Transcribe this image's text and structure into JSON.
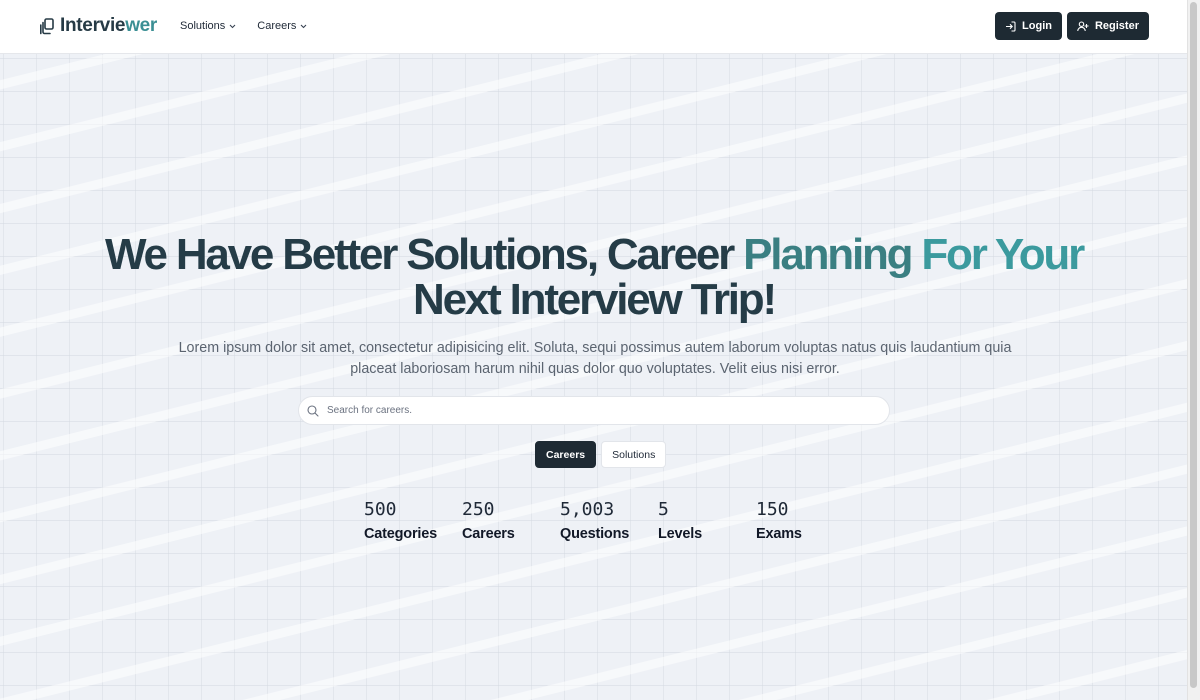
{
  "brand": {
    "name_part1": "Intervie",
    "name_part2": "wer",
    "accent_color": "#3b8f94",
    "dark_color": "#1e2a33"
  },
  "nav": {
    "items": [
      {
        "label": "Solutions",
        "icon": "chevron-down-icon"
      },
      {
        "label": "Careers",
        "icon": "chevron-down-icon"
      }
    ],
    "login_label": "Login",
    "login_icon": "login-icon",
    "register_label": "Register",
    "register_icon": "user-plus-icon"
  },
  "hero": {
    "headline_part1": "We Have Better Solutions, Career ",
    "headline_part2": "Planning ",
    "headline_part3": "For Your",
    "headline_part4": "Next Interview Trip!",
    "subtitle": "Lorem ipsum dolor sit amet, consectetur adipisicing elit. Soluta, sequi possimus autem laborum voluptas natus quis laudantium quia placeat laboriosam harum nihil quas dolor quo voluptates. Velit eius nisi error."
  },
  "search": {
    "placeholder": "Search for careers.",
    "value": "",
    "icon": "search-icon"
  },
  "tabs": [
    {
      "label": "Careers",
      "active": true
    },
    {
      "label": "Solutions",
      "active": false
    }
  ],
  "stats": [
    {
      "value": "500",
      "label": "Categories"
    },
    {
      "value": "250",
      "label": "Careers"
    },
    {
      "value": "5,003",
      "label": "Questions"
    },
    {
      "value": "5",
      "label": "Levels"
    },
    {
      "value": "150",
      "label": "Exams"
    }
  ]
}
